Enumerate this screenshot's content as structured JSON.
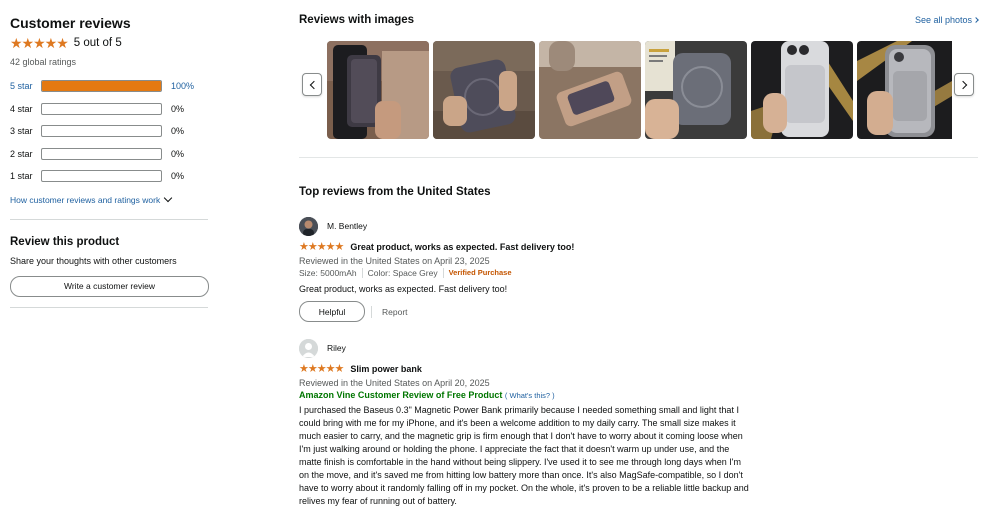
{
  "summary": {
    "title": "Customer reviews",
    "stars": "★★★★★",
    "out_of": "5 out of 5",
    "global_ratings": "42 global ratings",
    "histogram": [
      {
        "label": "5 star",
        "percent_text": "100%",
        "percent": 100
      },
      {
        "label": "4 star",
        "percent_text": "0%",
        "percent": 0
      },
      {
        "label": "3 star",
        "percent_text": "0%",
        "percent": 0
      },
      {
        "label": "2 star",
        "percent_text": "0%",
        "percent": 0
      },
      {
        "label": "1 star",
        "percent_text": "0%",
        "percent": 0
      }
    ],
    "how_link": "How customer reviews and ratings work"
  },
  "review_product": {
    "title": "Review this product",
    "subtitle": "Share your thoughts with other customers",
    "button": "Write a customer review"
  },
  "images_section": {
    "title": "Reviews with images",
    "see_all": "See all photos",
    "thumbnails": [
      {
        "icon": "photo-power-bank-on-phone"
      },
      {
        "icon": "photo-power-bank-in-hand"
      },
      {
        "icon": "photo-power-bank-side"
      },
      {
        "icon": "photo-power-bank-with-box"
      },
      {
        "icon": "photo-power-bank-silver"
      },
      {
        "icon": "photo-power-bank-clear-case"
      }
    ]
  },
  "top_reviews_title": "Top reviews from the United States",
  "reviews": [
    {
      "name": "M. Bentley",
      "stars": "★★★★★",
      "title": "Great product, works as expected. Fast delivery too!",
      "date": "Reviewed in the United States on April 23, 2025",
      "size": "Size: 5000mAh",
      "color": "Color: Space Grey",
      "verified": "Verified Purchase",
      "body": "Great product, works as expected. Fast delivery too!",
      "helpful": "Helpful",
      "report": "Report"
    },
    {
      "name": "Riley",
      "stars": "★★★★★",
      "title": "Slim power bank",
      "date": "Reviewed in the United States on April 20, 2025",
      "vine": "Amazon Vine Customer Review of Free Product",
      "whats_this": "( What's this? )",
      "body": "I purchased the Baseus 0.3\" Magnetic Power Bank primarily because I needed something small and light that I could bring with me for my iPhone, and it's been a welcome addition to my daily carry. The small size makes it much easier to carry, and the magnetic grip is firm enough that I don't have to worry about it coming loose when I'm just walking around or holding the phone. I appreciate the fact that it doesn't warm up under use, and the matte finish is comfortable in the hand without being slippery. I've used it to see me through long days when I'm on the move, and it's saved me from hitting low battery more than once. It's also MagSafe-compatible, so I don't have to worry about it randomly falling off in my pocket. On the whole, it's proven to be a reliable little backup and relives my fear of running out of battery."
    }
  ],
  "colors": {
    "star": "#de7921",
    "bar_fill": "#e47911",
    "link": "#2162a1",
    "verified": "#c45500",
    "vine": "#007600"
  }
}
